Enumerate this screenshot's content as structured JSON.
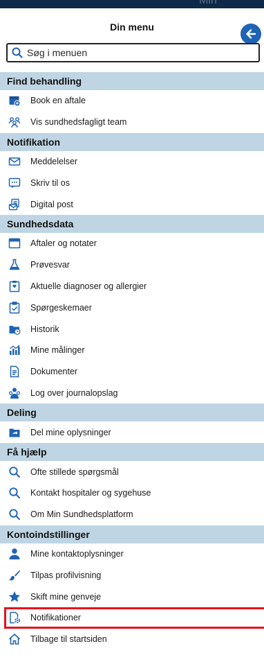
{
  "header": {
    "title": "Din menu",
    "ghost_text": "Min"
  },
  "search": {
    "placeholder": "Søg i menuen"
  },
  "colors": {
    "accent": "#1f63b5",
    "section_bg": "#bfd5e4",
    "highlight": "#e8101c"
  },
  "sections": [
    {
      "title": "Find behandling",
      "items": [
        {
          "label": "Book en aftale",
          "icon": "calendar-plus-icon"
        },
        {
          "label": "Vis sundhedsfagligt team",
          "icon": "team-icon"
        }
      ]
    },
    {
      "title": "Notifikation",
      "items": [
        {
          "label": "Meddelelser",
          "icon": "envelope-icon"
        },
        {
          "label": "Skriv til os",
          "icon": "chat-icon"
        },
        {
          "label": "Digital post",
          "icon": "digital-post-icon"
        }
      ]
    },
    {
      "title": "Sundhedsdata",
      "items": [
        {
          "label": "Aftaler og notater",
          "icon": "calendar-icon"
        },
        {
          "label": "Prøvesvar",
          "icon": "flask-icon"
        },
        {
          "label": "Aktuelle diagnoser og allergier",
          "icon": "clipboard-icon"
        },
        {
          "label": "Spørgeskemaer",
          "icon": "questionnaire-icon"
        },
        {
          "label": "Historik",
          "icon": "folder-clock-icon"
        },
        {
          "label": "Mine målinger",
          "icon": "chart-icon"
        },
        {
          "label": "Dokumenter",
          "icon": "document-icon"
        },
        {
          "label": "Log over journalopslag",
          "icon": "log-person-icon"
        }
      ]
    },
    {
      "title": "Deling",
      "items": [
        {
          "label": "Del mine oplysninger",
          "icon": "folder-share-icon"
        }
      ]
    },
    {
      "title": "Få hjælp",
      "items": [
        {
          "label": "Ofte stillede spørgsmål",
          "icon": "search-icon"
        },
        {
          "label": "Kontakt hospitaler og sygehuse",
          "icon": "search-icon"
        },
        {
          "label": "Om Min Sundhedsplatform",
          "icon": "search-icon"
        }
      ]
    },
    {
      "title": "Kontoindstillinger",
      "items": [
        {
          "label": "Mine kontaktoplysninger",
          "icon": "person-icon"
        },
        {
          "label": "Tilpas profilvisning",
          "icon": "brush-icon"
        },
        {
          "label": "Skift mine genveje",
          "icon": "star-icon"
        },
        {
          "label": "Notifikationer",
          "icon": "notification-settings-icon",
          "highlighted": true
        },
        {
          "label": "Tilbage til startsiden",
          "icon": "home-icon"
        }
      ]
    }
  ]
}
